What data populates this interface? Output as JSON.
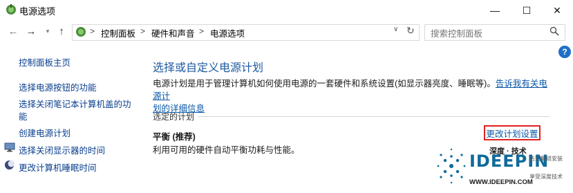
{
  "window": {
    "title": "电源选项",
    "controls": {
      "minimize": "—",
      "maximize": "☐",
      "close": "✕"
    }
  },
  "address": {
    "breadcrumb": [
      "控制面板",
      "硬件和声音",
      "电源选项"
    ],
    "separator": ">",
    "search_placeholder": "搜索控制面板"
  },
  "sidebar": {
    "items": [
      {
        "label": "控制面板主页"
      },
      {
        "label": "选择电源按钮的功能"
      },
      {
        "label": "选择关闭笔记本计算机盖的功"
      },
      {
        "label": "能"
      },
      {
        "label": "创建电源计划"
      },
      {
        "label": "选择关闭显示器的时间",
        "icon": "monitor-icon"
      },
      {
        "label": "更改计算机睡眠时间",
        "icon": "moon-icon"
      }
    ]
  },
  "main": {
    "heading": "选择或自定义电源计划",
    "description_text": "电源计划是用于管理计算机如何使用电源的一套硬件和系统设置(如显示器亮度、睡眠等)。",
    "description_link_1": "告诉我有关电源计",
    "description_link_2": "划的详细信息",
    "section_label": "选定的计划",
    "plan": {
      "name": "平衡 (推荐)",
      "description": "利用可用的硬件自动平衡功耗与性能。",
      "change_link": "更改计划设置"
    },
    "help": "?"
  },
  "watermark": {
    "line1": "深度 · 技术",
    "brand": "IDEEPIN",
    "tag1": "告别繁琐安装",
    "tag2": "享受深度技术",
    "url": "WWW.IDEEPIN.COM"
  },
  "colors": {
    "link": "#0a57a8",
    "heading": "#1e5aa0",
    "highlight_border": "#e02020"
  }
}
